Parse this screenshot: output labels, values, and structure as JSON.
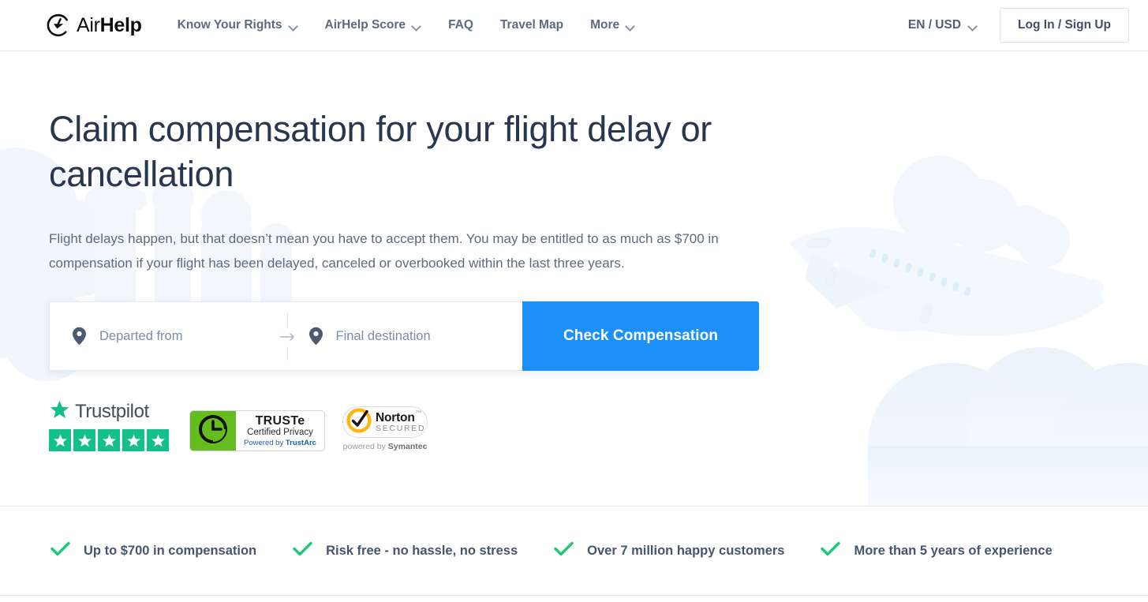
{
  "header": {
    "logo": {
      "icon": "airhelp-logo-icon",
      "text_light": "Air",
      "text_bold": "Help"
    },
    "nav": [
      {
        "label": "Know Your Rights",
        "has_dropdown": true
      },
      {
        "label": "AirHelp Score",
        "has_dropdown": true
      },
      {
        "label": "FAQ",
        "has_dropdown": false
      },
      {
        "label": "Travel Map",
        "has_dropdown": false
      },
      {
        "label": "More",
        "has_dropdown": true
      }
    ],
    "locale": {
      "label": "EN / USD",
      "has_dropdown": true
    },
    "login_label": "Log In / Sign Up"
  },
  "hero": {
    "title": "Claim compensation for your flight delay or cancellation",
    "subtitle": "Flight delays happen, but that doesn’t mean you have to accept them. You may be entitled to as much as $700 in compensation if your flight has been delayed, canceled or overbooked within the last three years.",
    "search": {
      "departure": {
        "placeholder": "Departed from",
        "value": "",
        "icon": "location-pin-icon"
      },
      "destination": {
        "placeholder": "Final destination",
        "value": "",
        "icon": "location-pin-icon"
      },
      "separator_icon": "arrow-right-icon",
      "submit_label": "Check Compensation"
    },
    "background": {
      "illustration": "airplane-and-clouds-illustration",
      "cloud_color": "#eef5fd"
    }
  },
  "badges": {
    "trustpilot": {
      "name": "Trustpilot",
      "star_icon": "star-icon",
      "star_count": 5,
      "star_color": "#13c08b"
    },
    "truste": {
      "mark_icon": "truste-e-icon",
      "line1": "TRUSTe",
      "line2": "Certified Privacy",
      "line3_prefix": "Powered by ",
      "line3_brand": "TrustArc",
      "panel_color": "#65bc1e"
    },
    "norton": {
      "check_icon": "norton-check-icon",
      "line1": "Norton",
      "line2": "SECURED",
      "trademark": "™",
      "footer_prefix": "powered by ",
      "footer_brand": "Symantec",
      "ring_color": "#ffb511"
    }
  },
  "features": [
    {
      "icon": "check-icon",
      "label": "Up to $700 in compensation"
    },
    {
      "icon": "check-icon",
      "label": "Risk free - no hassle, no stress"
    },
    {
      "icon": "check-icon",
      "label": "Over 7 million happy customers"
    },
    {
      "icon": "check-icon",
      "label": "More than 5 years of experience"
    }
  ],
  "colors": {
    "accent_blue": "#1d8ff8",
    "heading_navy": "#28364e",
    "body_slate": "#5a6b82",
    "check_green": "#1fc77b",
    "border_light": "#dde5ef"
  }
}
